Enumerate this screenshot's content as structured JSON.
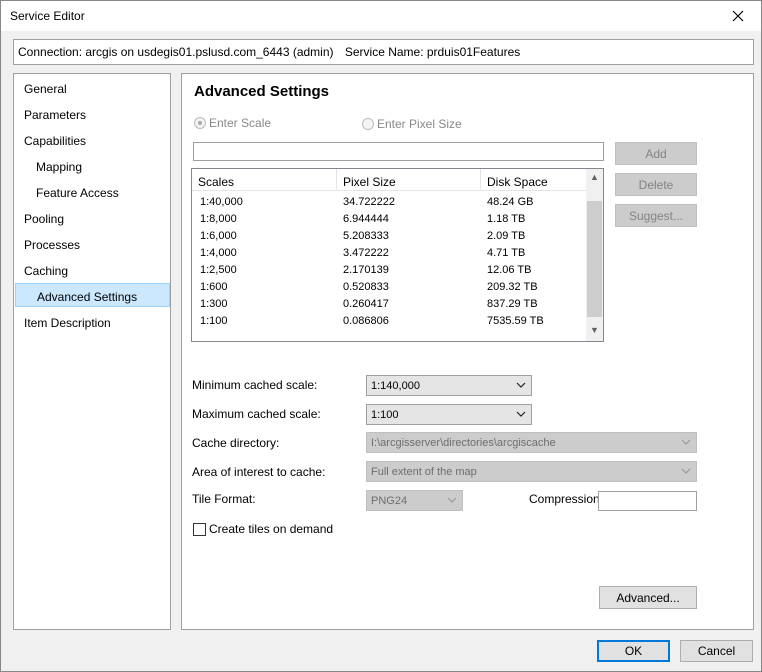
{
  "window": {
    "title": "Service Editor"
  },
  "connection": {
    "connection_text": "Connection: arcgis on usdegis01.pslusd.com_6443 (admin)",
    "service_text": "Service Name: prduis01Features"
  },
  "nav": {
    "items": [
      {
        "label": "General"
      },
      {
        "label": "Parameters"
      },
      {
        "label": "Capabilities"
      },
      {
        "label": "Mapping"
      },
      {
        "label": "Feature Access"
      },
      {
        "label": "Pooling"
      },
      {
        "label": "Processes"
      },
      {
        "label": "Caching"
      },
      {
        "label": "Advanced Settings"
      },
      {
        "label": "Item Description"
      }
    ],
    "selected": "Advanced Settings"
  },
  "panel": {
    "heading": "Advanced Settings",
    "radio_scale": "Enter Scale",
    "radio_pixel": "Enter Pixel Size",
    "scale_input_value": "",
    "buttons": {
      "add": "Add",
      "delete": "Delete",
      "suggest": "Suggest..."
    },
    "table": {
      "headers": [
        "Scales",
        "Pixel Size",
        "Disk Space"
      ],
      "rows": [
        [
          "1:40,000",
          "34.722222",
          "48.24 GB"
        ],
        [
          "1:8,000",
          "6.944444",
          "1.18 TB"
        ],
        [
          "1:6,000",
          "5.208333",
          "2.09 TB"
        ],
        [
          "1:4,000",
          "3.472222",
          "4.71 TB"
        ],
        [
          "1:2,500",
          "2.170139",
          "12.06 TB"
        ],
        [
          "1:600",
          "0.520833",
          "209.32 TB"
        ],
        [
          "1:300",
          "0.260417",
          "837.29 TB"
        ],
        [
          "1:100",
          "0.086806",
          "7535.59 TB"
        ]
      ]
    },
    "min_scale_label": "Minimum cached scale:",
    "min_scale_value": "1:140,000",
    "max_scale_label": "Maximum cached scale:",
    "max_scale_value": "1:100",
    "cache_dir_label": "Cache directory:",
    "cache_dir_value": "I:\\arcgisserver\\directories\\arcgiscache",
    "aoi_label": "Area of interest to cache:",
    "aoi_value": "Full extent of the map",
    "tile_format_label": "Tile Format:",
    "tile_format_value": "PNG24",
    "compression_label": "Compression:",
    "compression_value": "",
    "on_demand_label": "Create tiles on demand",
    "advanced_button": "Advanced..."
  },
  "footer": {
    "ok": "OK",
    "cancel": "Cancel"
  }
}
